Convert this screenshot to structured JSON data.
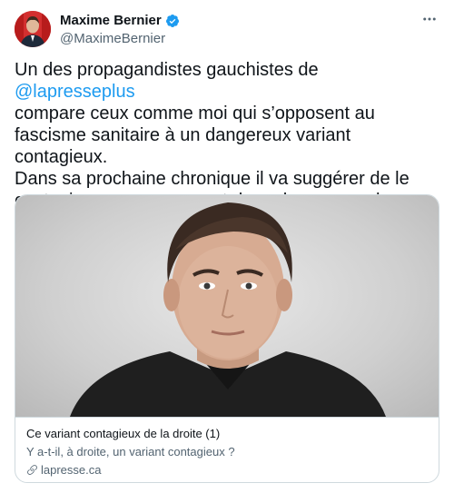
{
  "author": {
    "name": "Maxime Bernier",
    "handle": "@MaximeBernier"
  },
  "icons": {
    "verified": "verified-badge-icon",
    "more": "more-dots-icon",
    "link": "link-icon"
  },
  "tweet": {
    "text_before_mention": "Un des propagandistes gauchistes de ",
    "mention": "@lapresseplus",
    "text_after_mention": "\ncompare ceux comme moi qui s’opposent au fascisme sanitaire à un dangereux variant contagieux.\nDans sa prochaine chronique il va suggérer de le contenir en nous envoyant dans des camps de concentration."
  },
  "card": {
    "title": "Ce variant contagieux de la droite (1)",
    "description": "Y a-t-il, à droite, un variant contagieux ?",
    "domain": "lapresse.ca"
  },
  "colors": {
    "accent": "#1d9bf0",
    "text": "#0f1419",
    "secondary": "#536471",
    "border": "#cfd9de"
  }
}
